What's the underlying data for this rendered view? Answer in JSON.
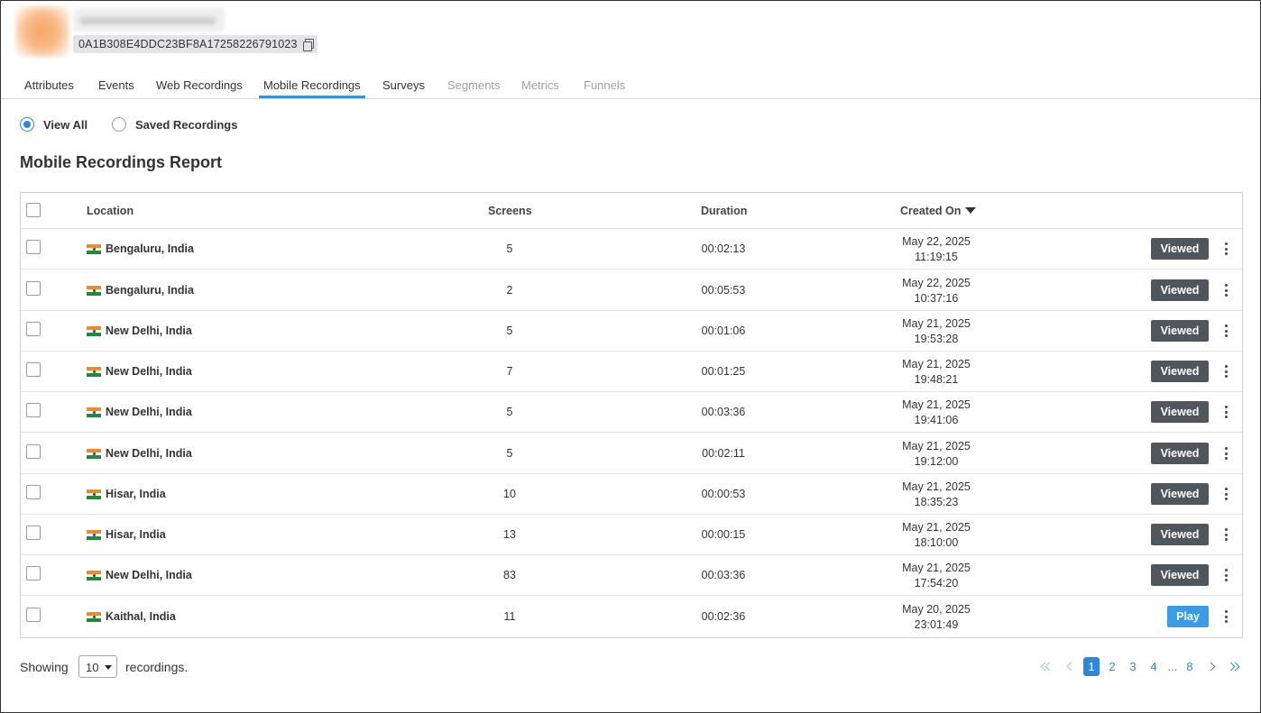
{
  "user": {
    "uid": "0A1B308E4DDC23BF8A17258226791023"
  },
  "tabs": [
    {
      "label": "Attributes",
      "state": "normal"
    },
    {
      "label": "Events",
      "state": "normal"
    },
    {
      "label": "Web Recordings",
      "state": "normal"
    },
    {
      "label": "Mobile Recordings",
      "state": "active"
    },
    {
      "label": "Surveys",
      "state": "normal"
    },
    {
      "label": "Segments",
      "state": "disabled"
    },
    {
      "label": "Metrics",
      "state": "disabled"
    },
    {
      "label": "Funnels",
      "state": "disabled"
    }
  ],
  "filters": {
    "view_all": "View All",
    "saved_recordings": "Saved Recordings",
    "selected": "View All"
  },
  "report": {
    "title": "Mobile Recordings Report",
    "columns": {
      "location": "Location",
      "screens": "Screens",
      "duration": "Duration",
      "created_on": "Created On"
    },
    "rows": [
      {
        "location": "Bengaluru, India",
        "screens": "5",
        "duration": "00:02:13",
        "date": "May 22, 2025",
        "time": "11:19:15",
        "status": "Viewed"
      },
      {
        "location": "Bengaluru, India",
        "screens": "2",
        "duration": "00:05:53",
        "date": "May 22, 2025",
        "time": "10:37:16",
        "status": "Viewed"
      },
      {
        "location": "New Delhi, India",
        "screens": "5",
        "duration": "00:01:06",
        "date": "May 21, 2025",
        "time": "19:53:28",
        "status": "Viewed"
      },
      {
        "location": "New Delhi, India",
        "screens": "7",
        "duration": "00:01:25",
        "date": "May 21, 2025",
        "time": "19:48:21",
        "status": "Viewed"
      },
      {
        "location": "New Delhi, India",
        "screens": "5",
        "duration": "00:03:36",
        "date": "May 21, 2025",
        "time": "19:41:06",
        "status": "Viewed"
      },
      {
        "location": "New Delhi, India",
        "screens": "5",
        "duration": "00:02:11",
        "date": "May 21, 2025",
        "time": "19:12:00",
        "status": "Viewed"
      },
      {
        "location": "Hisar, India",
        "screens": "10",
        "duration": "00:00:53",
        "date": "May 21, 2025",
        "time": "18:35:23",
        "status": "Viewed"
      },
      {
        "location": "Hisar, India",
        "screens": "13",
        "duration": "00:00:15",
        "date": "May 21, 2025",
        "time": "18:10:00",
        "status": "Viewed"
      },
      {
        "location": "New Delhi, India",
        "screens": "83",
        "duration": "00:03:36",
        "date": "May 21, 2025",
        "time": "17:54:20",
        "status": "Viewed"
      },
      {
        "location": "Kaithal, India",
        "screens": "11",
        "duration": "00:02:36",
        "date": "May 20, 2025",
        "time": "23:01:49",
        "status": "Play"
      }
    ]
  },
  "footer": {
    "showing_label": "Showing",
    "page_size": "10",
    "recordings_label": "recordings.",
    "pages": [
      "1",
      "2",
      "3",
      "4",
      "...",
      "8"
    ],
    "current_page": "1"
  },
  "colors": {
    "accent": "#2f86dd",
    "viewed_button": "#4f565d",
    "play_button": "#3a9be6"
  }
}
